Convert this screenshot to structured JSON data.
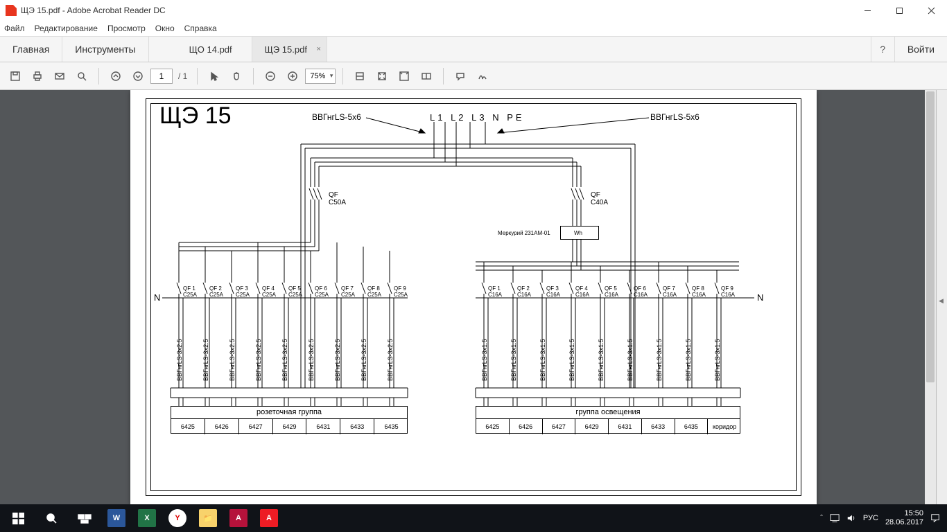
{
  "window": {
    "title": "ЩЭ 15.pdf - Adobe Acrobat Reader DC"
  },
  "menu": {
    "file": "Файл",
    "edit": "Редактирование",
    "view": "Просмотр",
    "window": "Окно",
    "help": "Справка"
  },
  "approw": {
    "home": "Главная",
    "tools": "Инструменты",
    "tabs": [
      {
        "label": "ЩО 14.pdf"
      },
      {
        "label": "ЩЭ 15.pdf"
      }
    ],
    "login": "Войти"
  },
  "toolbar": {
    "page": "1",
    "pages": "1",
    "zoom": "75%"
  },
  "diagram": {
    "title": "ЩЭ 15",
    "cable_in_left": "ВВГнгLS-5х6",
    "cable_in_right": "ВВГнгLS-5х6",
    "phases": "L1 L2 L3 N  PE",
    "qf_left": {
      "name": "QF",
      "rating": "C50A"
    },
    "qf_right": {
      "name": "QF",
      "rating": "C40A"
    },
    "meter": {
      "model": "Меркурий 231AM-01",
      "unit": "Wh"
    },
    "bus_n_left": "N",
    "bus_n_right": "N",
    "left_group": {
      "title": "розеточная группа",
      "breakers": [
        {
          "n": "QF 1",
          "r": "C25A"
        },
        {
          "n": "QF 2",
          "r": "C25A"
        },
        {
          "n": "QF 3",
          "r": "C25A"
        },
        {
          "n": "QF 4",
          "r": "C25A"
        },
        {
          "n": "QF 5",
          "r": "C25A"
        },
        {
          "n": "QF 6",
          "r": "C25A"
        },
        {
          "n": "QF 7",
          "r": "C25A"
        },
        {
          "n": "QF 8",
          "r": "C25A"
        },
        {
          "n": "QF 9",
          "r": "C25A"
        }
      ],
      "cable": "ВВГнгLS-3х2.5",
      "cells": [
        "6425",
        "6426",
        "6427",
        "6429",
        "6431",
        "6433",
        "6435"
      ]
    },
    "right_group": {
      "title": "группа освещения",
      "breakers": [
        {
          "n": "QF 1",
          "r": "C16A"
        },
        {
          "n": "QF 2",
          "r": "C16A"
        },
        {
          "n": "QF 3",
          "r": "C16A"
        },
        {
          "n": "QF 4",
          "r": "C16A"
        },
        {
          "n": "QF 5",
          "r": "C16A"
        },
        {
          "n": "QF 6",
          "r": "C16A"
        },
        {
          "n": "QF 7",
          "r": "C16A"
        },
        {
          "n": "QF 8",
          "r": "C16A"
        },
        {
          "n": "QF 9",
          "r": "C16A"
        }
      ],
      "cable": "ВВГнгLS-3х1.5",
      "cells": [
        "6425",
        "6426",
        "6427",
        "6429",
        "6431",
        "6433",
        "6435",
        "коридор"
      ]
    }
  },
  "taskbar": {
    "lang": "РУС",
    "time": "15:50",
    "date": "28.06.2017"
  }
}
